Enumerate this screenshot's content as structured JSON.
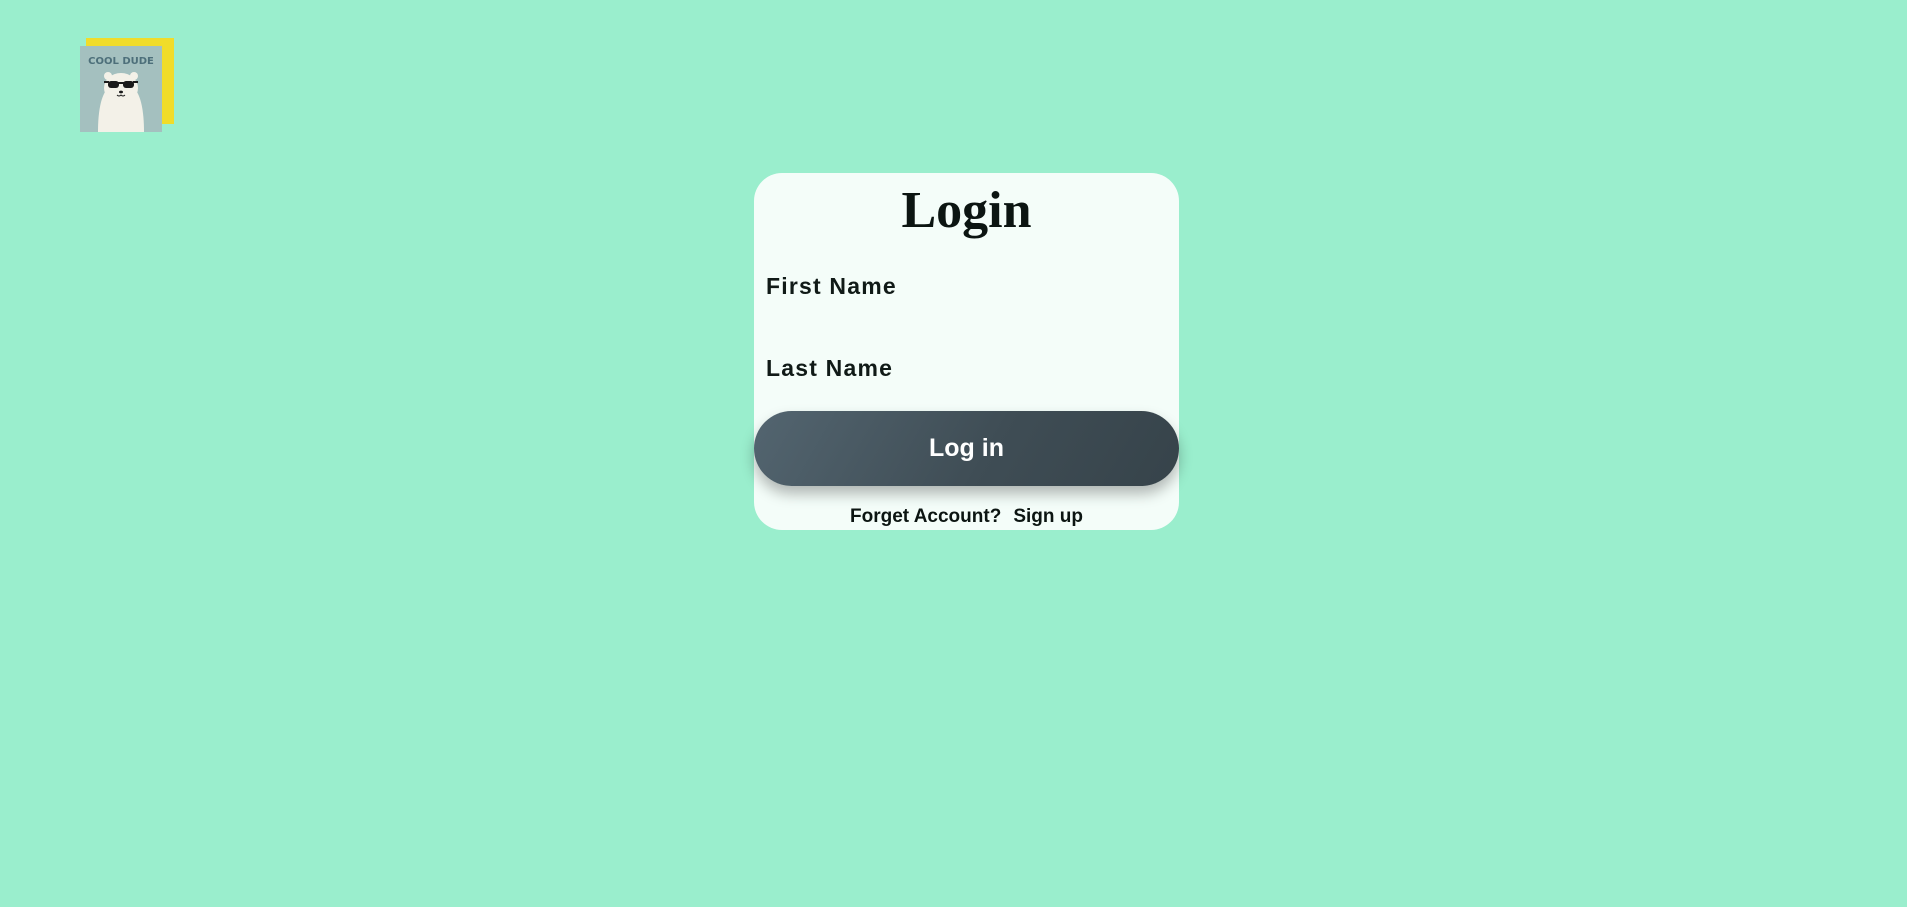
{
  "logo": {
    "text": "COOL DUDE",
    "icon": "polar-bear-sunglasses-icon",
    "colors": {
      "back_card": "#f0dc2a",
      "front_card": "#a4c0bf",
      "text": "#4d6f7a"
    }
  },
  "login": {
    "title": "Login",
    "first_name_label": "First Name",
    "first_name_value": "",
    "last_name_label": "Last Name",
    "last_name_value": "",
    "submit_label": "Log in",
    "forget_link": "Forget Account?",
    "signup_link": "Sign up"
  },
  "colors": {
    "background": "#9aeecd",
    "card": "#f4fdf9",
    "button": "#45545c",
    "text": "#0c1512"
  }
}
